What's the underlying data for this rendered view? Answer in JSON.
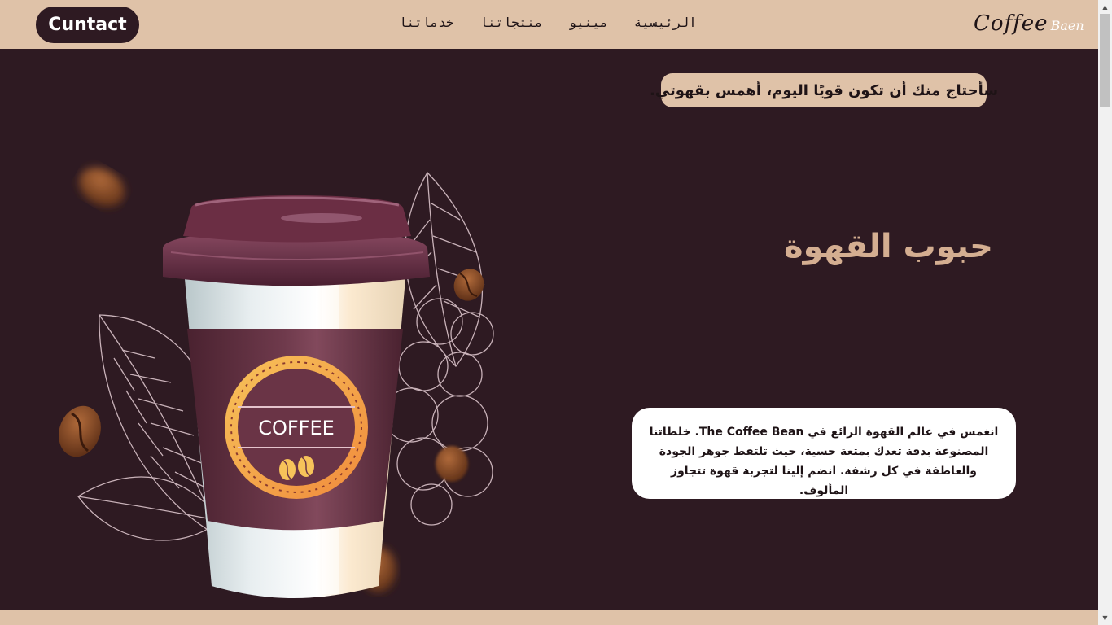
{
  "nav": {
    "contact_label": "Cuntact",
    "links": [
      "الرئيسية",
      "مينيو",
      "منتجاتنا",
      "خدماتنا"
    ],
    "logo_main": "Coffee",
    "logo_sub": "Baen"
  },
  "hero": {
    "quote": "سأحتاج منك أن تكون قويًا اليوم، أهمس بقهوتي.",
    "title": "حبوب القهوة",
    "description": "انغمس في عالم القهوة الرائع في The Coffee Bean. خلطاتنا المصنوعة بدقة تعدك بمتعة حسية، حيث تلتقط جوهر الجودة والعاطفة في كل رشفة. انضم إلينا لتجربة قهوة تتجاوز المألوف.",
    "cup_label": "COFFEE"
  },
  "colors": {
    "dark_bg": "#2e1a22",
    "beige": "#dfc2a8",
    "title_color": "#d4ae91",
    "cup_lid": "#6b2e44",
    "cup_sleeve": "#5a2a3a"
  }
}
